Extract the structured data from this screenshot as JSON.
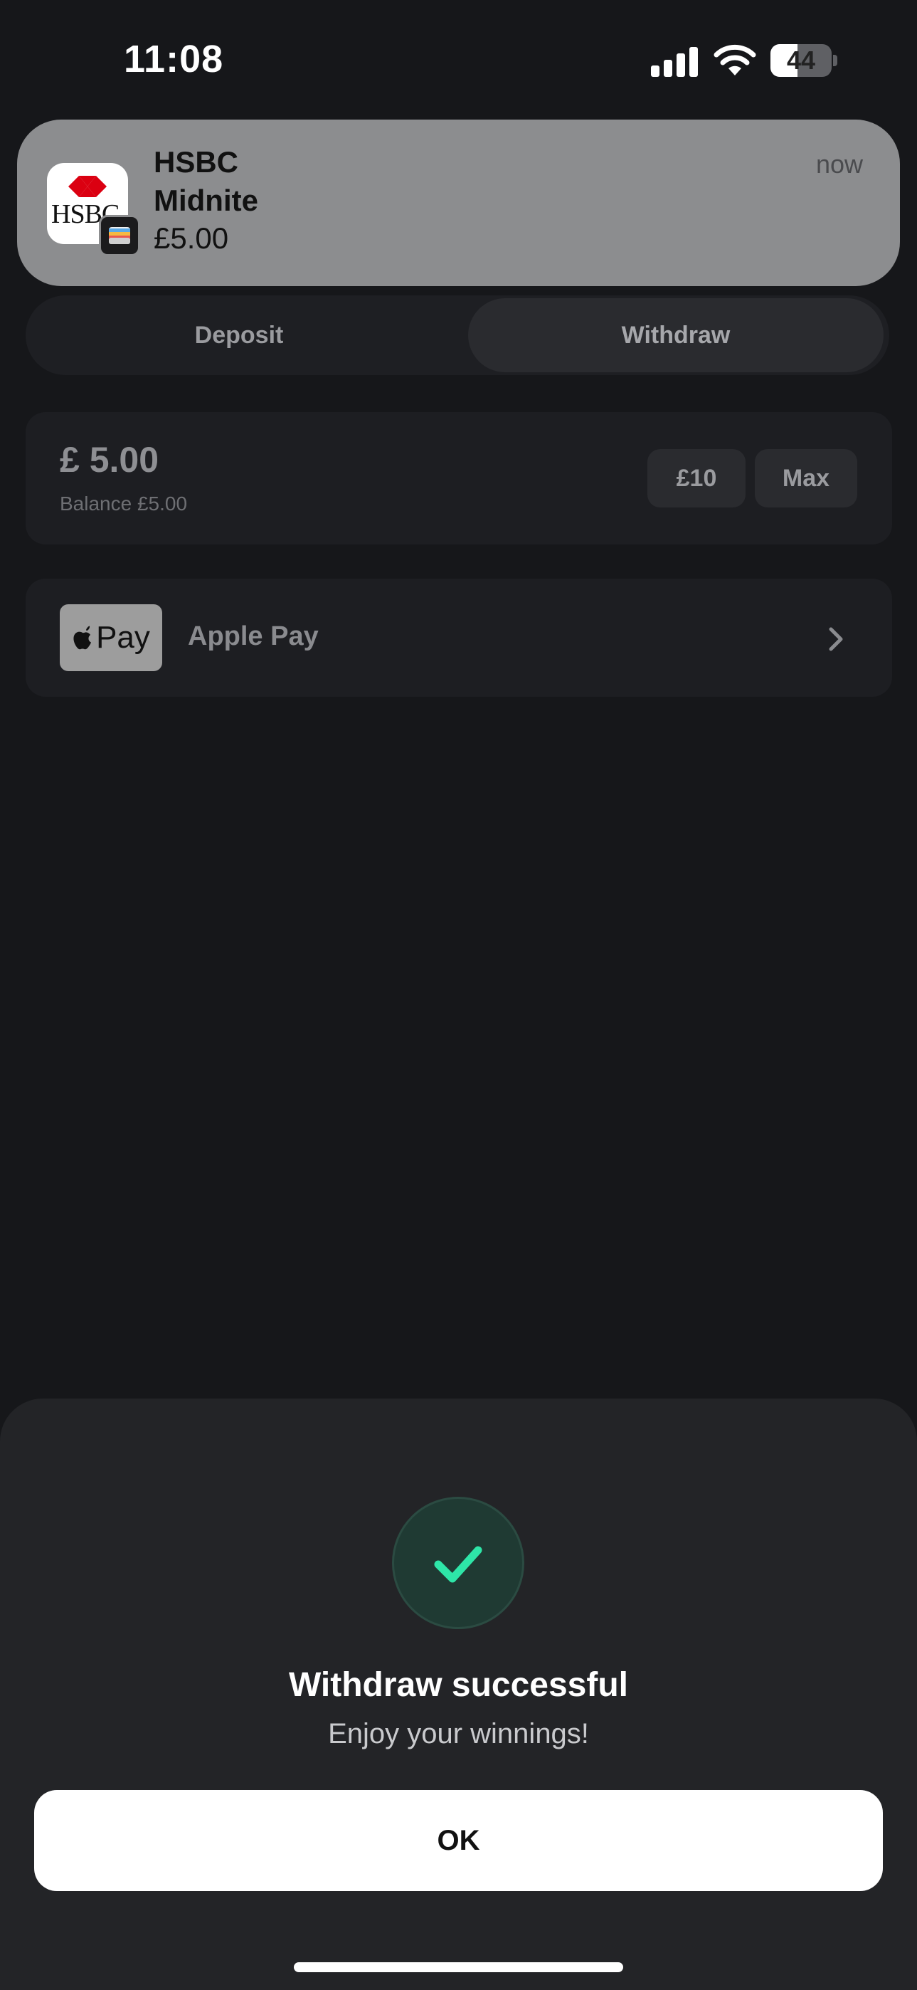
{
  "status_bar": {
    "time": "11:08",
    "battery_level": "44"
  },
  "notification": {
    "app_icon": "hsbc-logo",
    "icon_text": "HSBC",
    "title": "HSBC",
    "subtitle": "Midnite",
    "body": "£5.00",
    "time": "now"
  },
  "tabs": [
    {
      "label": "Deposit",
      "selected": false
    },
    {
      "label": "Withdraw",
      "selected": true
    }
  ],
  "amount": {
    "value": "£ 5.00",
    "balance": "Balance £5.00",
    "quick_options": [
      "£10",
      "Max"
    ]
  },
  "payment_method": {
    "badge_text": "Pay",
    "label": "Apple Pay",
    "icon": "apple-icon"
  },
  "success_sheet": {
    "icon": "check-icon",
    "title": "Withdraw successful",
    "subtitle": "Enjoy your winnings!",
    "button_label": "OK",
    "accent_color": "#2ee6a8"
  }
}
